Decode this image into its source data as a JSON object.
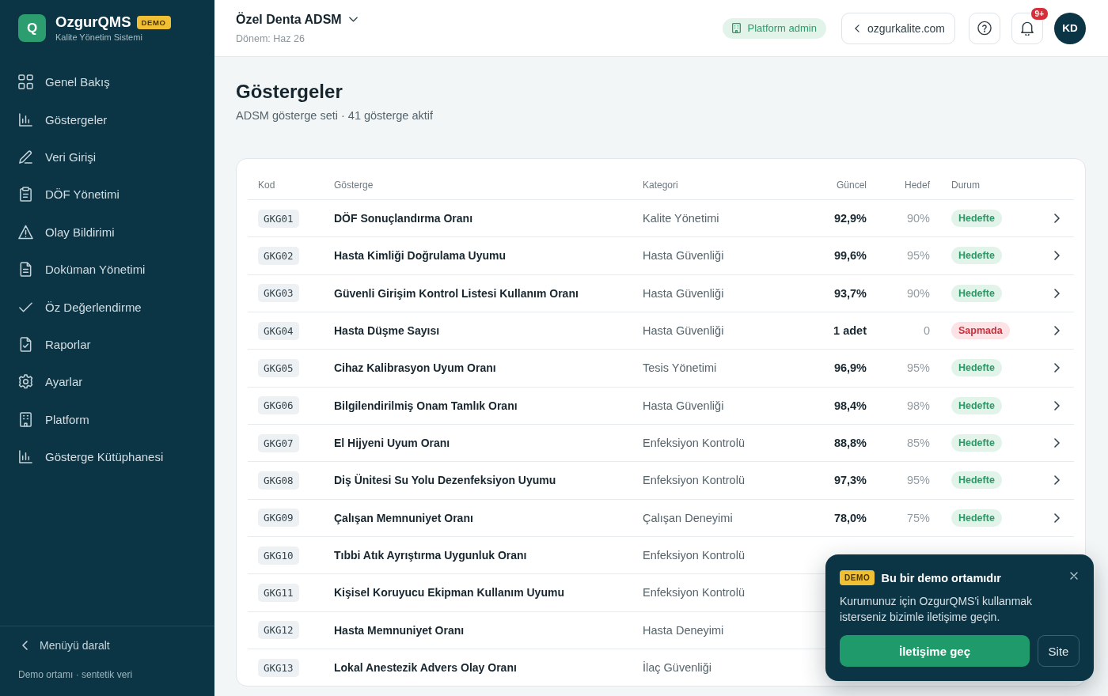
{
  "sidebar": {
    "brand": {
      "logo_letter": "Q",
      "name": "OzgurQMS",
      "badge": "DEMO",
      "subtitle": "Kalite Yönetim Sistemi"
    },
    "items": [
      {
        "label": "Genel Bakış"
      },
      {
        "label": "Göstergeler"
      },
      {
        "label": "Veri Girişi"
      },
      {
        "label": "DÖF Yönetimi"
      },
      {
        "label": "Olay Bildirimi"
      },
      {
        "label": "Doküman Yönetimi"
      },
      {
        "label": "Öz Değerlendirme"
      },
      {
        "label": "Raporlar"
      },
      {
        "label": "Ayarlar"
      },
      {
        "label": "Platform"
      },
      {
        "label": "Gösterge Kütüphanesi"
      }
    ],
    "collapse": "Menüyü daralt",
    "footer_note": "Demo ortamı · sentetik veri"
  },
  "header": {
    "organization": "Özel Denta ADSM",
    "period": "Dönem: Haz 26",
    "role": "Platform admin",
    "site_link": "ozgurkalite.com",
    "notification_count": "9+",
    "avatar_initials": "KD"
  },
  "page": {
    "title": "Göstergeler",
    "subtitle": "ADSM gösterge seti · 41 gösterge aktif"
  },
  "table": {
    "columns": [
      "Kod",
      "Gösterge",
      "Kategori",
      "Güncel",
      "Hedef",
      "Durum"
    ],
    "rows": [
      {
        "code": "GKG01",
        "name": "DÖF Sonuçlandırma Oranı",
        "category": "Kalite Yönetimi",
        "current": "92,9%",
        "target": "90%",
        "status": {
          "label": "Hedefte",
          "kind": "on_target"
        }
      },
      {
        "code": "GKG02",
        "name": "Hasta Kimliği Doğrulama Uyumu",
        "category": "Hasta Güvenliği",
        "current": "99,6%",
        "target": "95%",
        "status": {
          "label": "Hedefte",
          "kind": "on_target"
        }
      },
      {
        "code": "GKG03",
        "name": "Güvenli Girişim Kontrol Listesi Kullanım Oranı",
        "category": "Hasta Güvenliği",
        "current": "93,7%",
        "target": "90%",
        "status": {
          "label": "Hedefte",
          "kind": "on_target"
        }
      },
      {
        "code": "GKG04",
        "name": "Hasta Düşme Sayısı",
        "category": "Hasta Güvenliği",
        "current": "1 adet",
        "target": "0",
        "status": {
          "label": "Sapmada",
          "kind": "deviation"
        }
      },
      {
        "code": "GKG05",
        "name": "Cihaz Kalibrasyon Uyum Oranı",
        "category": "Tesis Yönetimi",
        "current": "96,9%",
        "target": "95%",
        "status": {
          "label": "Hedefte",
          "kind": "on_target"
        }
      },
      {
        "code": "GKG06",
        "name": "Bilgilendirilmiş Onam Tamlık Oranı",
        "category": "Hasta Güvenliği",
        "current": "98,4%",
        "target": "98%",
        "status": {
          "label": "Hedefte",
          "kind": "on_target"
        }
      },
      {
        "code": "GKG07",
        "name": "El Hijyeni Uyum Oranı",
        "category": "Enfeksiyon Kontrolü",
        "current": "88,8%",
        "target": "85%",
        "status": {
          "label": "Hedefte",
          "kind": "on_target"
        }
      },
      {
        "code": "GKG08",
        "name": "Diş Ünitesi Su Yolu Dezenfeksiyon Uyumu",
        "category": "Enfeksiyon Kontrolü",
        "current": "97,3%",
        "target": "95%",
        "status": {
          "label": "Hedefte",
          "kind": "on_target"
        }
      },
      {
        "code": "GKG09",
        "name": "Çalışan Memnuniyet Oranı",
        "category": "Çalışan Deneyimi",
        "current": "78,0%",
        "target": "75%",
        "status": {
          "label": "Hedefte",
          "kind": "on_target"
        }
      },
      {
        "code": "GKG10",
        "name": "Tıbbi Atık Ayrıştırma Uygunluk Oranı",
        "category": "Enfeksiyon Kontrolü"
      },
      {
        "code": "GKG11",
        "name": "Kişisel Koruyucu Ekipman Kullanım Uyumu",
        "category": "Enfeksiyon Kontrolü"
      },
      {
        "code": "GKG12",
        "name": "Hasta Memnuniyet Oranı",
        "category": "Hasta Deneyimi"
      },
      {
        "code": "GKG13",
        "name": "Lokal Anestezik Advers Olay Oranı",
        "category": "İlaç Güvenliği"
      }
    ]
  },
  "demo_popup": {
    "badge": "DEMO",
    "title": "Bu bir demo ortamıdır",
    "message": "Kurumunuz için OzgurQMS'i kullanmak isterseniz bizimle iletişime geçin.",
    "primary_button": "İletişime geç",
    "secondary_button": "Site"
  }
}
